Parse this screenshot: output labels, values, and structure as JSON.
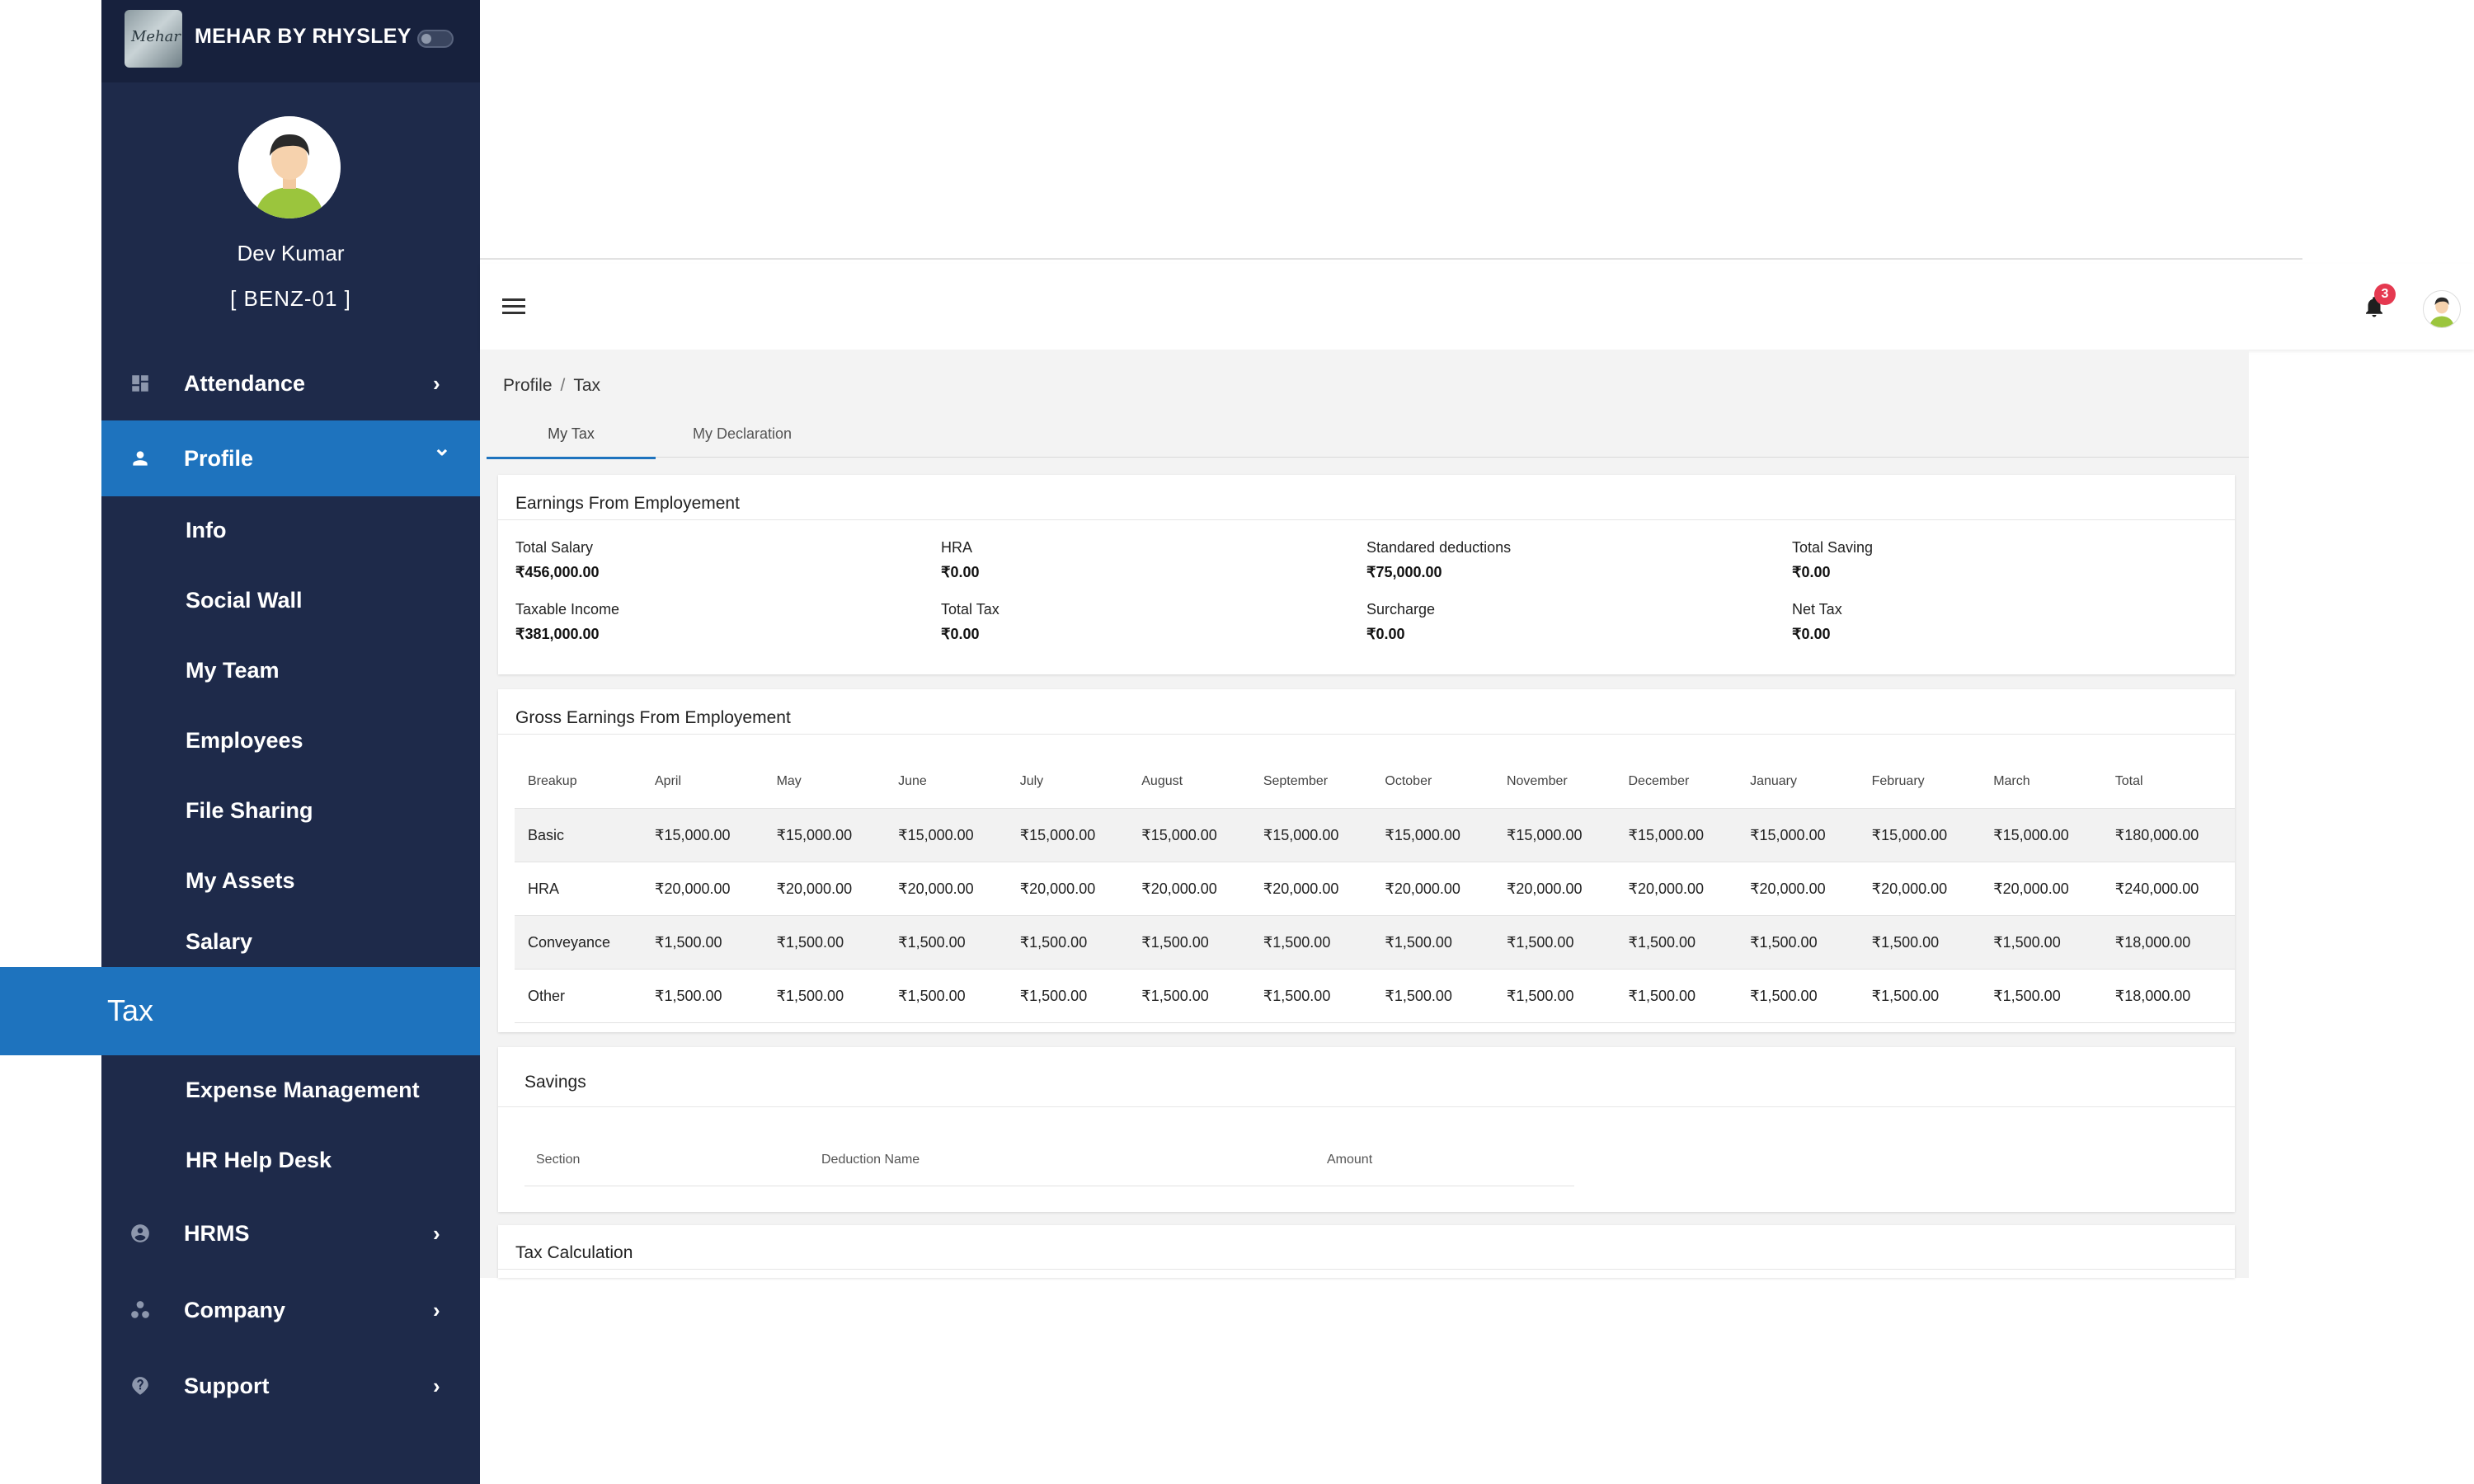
{
  "brand": {
    "name": "MEHAR BY RHYSLEY",
    "logo_text": "Mehar"
  },
  "user": {
    "name": "Dev Kumar",
    "code": "[ BENZ-01 ]"
  },
  "sidebar": {
    "items": [
      {
        "label": "Attendance",
        "icon": "dashboard-icon",
        "chevron": "›"
      },
      {
        "label": "Profile",
        "icon": "person-icon",
        "chevron": "⌄"
      },
      {
        "label": "HRMS",
        "icon": "account-circle-icon",
        "chevron": "›"
      },
      {
        "label": "Company",
        "icon": "group-work-icon",
        "chevron": "›"
      },
      {
        "label": "Support",
        "icon": "help-icon",
        "chevron": "›"
      }
    ],
    "profile_sub": [
      "Info",
      "Social Wall",
      "My Team",
      "Employees",
      "File Sharing",
      "My Assets",
      "Salary",
      "Tax",
      "Expense Management",
      "HR Help Desk"
    ]
  },
  "header": {
    "notification_count": "3"
  },
  "breadcrumb": {
    "parent": "Profile",
    "sep": "/",
    "current": "Tax"
  },
  "tabs": [
    "My Tax",
    "My Declaration"
  ],
  "earnings": {
    "title": "Earnings From Employement",
    "fields": [
      {
        "label": "Total Salary",
        "value": "₹456,000.00"
      },
      {
        "label": "HRA",
        "value": "₹0.00"
      },
      {
        "label": "Standared deductions",
        "value": "₹75,000.00"
      },
      {
        "label": "Total Saving",
        "value": "₹0.00"
      },
      {
        "label": "Taxable Income",
        "value": "₹381,000.00"
      },
      {
        "label": "Total Tax",
        "value": "₹0.00"
      },
      {
        "label": "Surcharge",
        "value": "₹0.00"
      },
      {
        "label": "Net Tax",
        "value": "₹0.00"
      }
    ]
  },
  "gross": {
    "title": "Gross Earnings From Employement",
    "columns": [
      "Breakup",
      "April",
      "May",
      "June",
      "July",
      "August",
      "September",
      "October",
      "November",
      "December",
      "January",
      "February",
      "March",
      "Total"
    ],
    "rows": [
      [
        "Basic",
        "₹15,000.00",
        "₹15,000.00",
        "₹15,000.00",
        "₹15,000.00",
        "₹15,000.00",
        "₹15,000.00",
        "₹15,000.00",
        "₹15,000.00",
        "₹15,000.00",
        "₹15,000.00",
        "₹15,000.00",
        "₹15,000.00",
        "₹180,000.00"
      ],
      [
        "HRA",
        "₹20,000.00",
        "₹20,000.00",
        "₹20,000.00",
        "₹20,000.00",
        "₹20,000.00",
        "₹20,000.00",
        "₹20,000.00",
        "₹20,000.00",
        "₹20,000.00",
        "₹20,000.00",
        "₹20,000.00",
        "₹20,000.00",
        "₹240,000.00"
      ],
      [
        "Conveyance",
        "₹1,500.00",
        "₹1,500.00",
        "₹1,500.00",
        "₹1,500.00",
        "₹1,500.00",
        "₹1,500.00",
        "₹1,500.00",
        "₹1,500.00",
        "₹1,500.00",
        "₹1,500.00",
        "₹1,500.00",
        "₹1,500.00",
        "₹18,000.00"
      ],
      [
        "Other",
        "₹1,500.00",
        "₹1,500.00",
        "₹1,500.00",
        "₹1,500.00",
        "₹1,500.00",
        "₹1,500.00",
        "₹1,500.00",
        "₹1,500.00",
        "₹1,500.00",
        "₹1,500.00",
        "₹1,500.00",
        "₹1,500.00",
        "₹18,000.00"
      ]
    ]
  },
  "savings": {
    "title": "Savings",
    "columns": [
      "Section",
      "Deduction Name",
      "Amount"
    ]
  },
  "tax_calc": {
    "title": "Tax Calculation"
  },
  "colors": {
    "sidebar": "#1e2a4a",
    "accent": "#1e73be",
    "badge": "#e53950"
  }
}
